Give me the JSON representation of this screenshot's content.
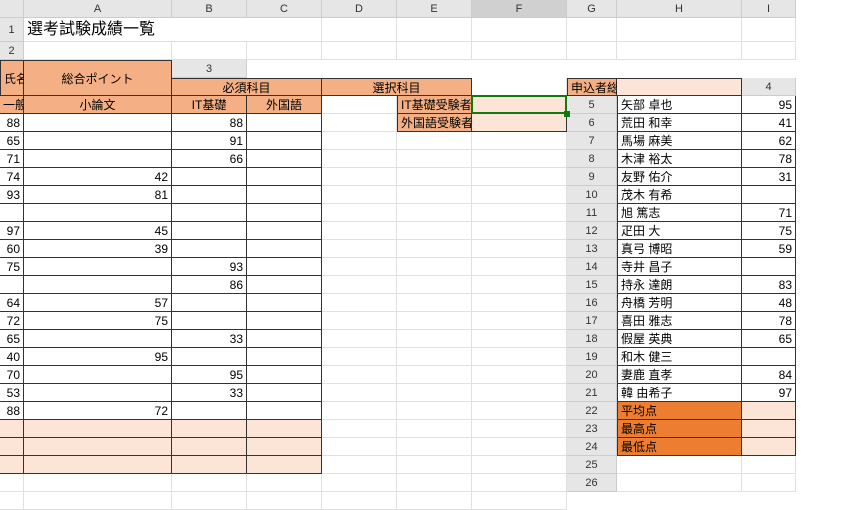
{
  "columns": [
    "A",
    "B",
    "C",
    "D",
    "E",
    "F",
    "G",
    "H",
    "I"
  ],
  "title": "選考試験成績一覧",
  "header": {
    "name": "氏名",
    "req_group": "必須科目",
    "opt_group": "選択科目",
    "total": "総合ポイント",
    "sub": {
      "gen": "一般常識",
      "essay": "小論文",
      "it": "IT基礎",
      "lang": "外国語"
    }
  },
  "rows": [
    {
      "name": "矢部 卓也",
      "gen": "95",
      "essay": "88",
      "it": "",
      "lang": "88"
    },
    {
      "name": "荒田 和幸",
      "gen": "41",
      "essay": "65",
      "it": "",
      "lang": "91"
    },
    {
      "name": "馬場 麻美",
      "gen": "62",
      "essay": "71",
      "it": "",
      "lang": "66"
    },
    {
      "name": "木津 裕太",
      "gen": "78",
      "essay": "74",
      "it": "42",
      "lang": ""
    },
    {
      "name": "友野 佑介",
      "gen": "31",
      "essay": "93",
      "it": "81",
      "lang": ""
    },
    {
      "name": "茂木 有希",
      "gen": "",
      "essay": "",
      "it": "",
      "lang": ""
    },
    {
      "name": "旭 篤志",
      "gen": "71",
      "essay": "97",
      "it": "45",
      "lang": ""
    },
    {
      "name": "疋田 大",
      "gen": "75",
      "essay": "60",
      "it": "39",
      "lang": ""
    },
    {
      "name": "真弓 博昭",
      "gen": "59",
      "essay": "75",
      "it": "",
      "lang": "93"
    },
    {
      "name": "寺井 昌子",
      "gen": "",
      "essay": "",
      "it": "",
      "lang": "86"
    },
    {
      "name": "持永 達朗",
      "gen": "83",
      "essay": "64",
      "it": "57",
      "lang": ""
    },
    {
      "name": "舟橋 芳明",
      "gen": "48",
      "essay": "72",
      "it": "75",
      "lang": ""
    },
    {
      "name": "喜田 雅志",
      "gen": "78",
      "essay": "65",
      "it": "",
      "lang": "33"
    },
    {
      "name": "假屋 英典",
      "gen": "65",
      "essay": "40",
      "it": "95",
      "lang": ""
    },
    {
      "name": "和木 健三",
      "gen": "",
      "essay": "70",
      "it": "",
      "lang": "95"
    },
    {
      "name": "妻鹿 直孝",
      "gen": "84",
      "essay": "53",
      "it": "",
      "lang": "33"
    },
    {
      "name": "韓 由希子",
      "gen": "97",
      "essay": "88",
      "it": "72",
      "lang": ""
    }
  ],
  "stats": {
    "avg": "平均点",
    "max": "最高点",
    "min": "最低点"
  },
  "side": {
    "applicants": "申込者総数",
    "it_takers": "IT基礎受験者数",
    "lang_takers": "外国語受験者数"
  },
  "selected_cell": "F5"
}
